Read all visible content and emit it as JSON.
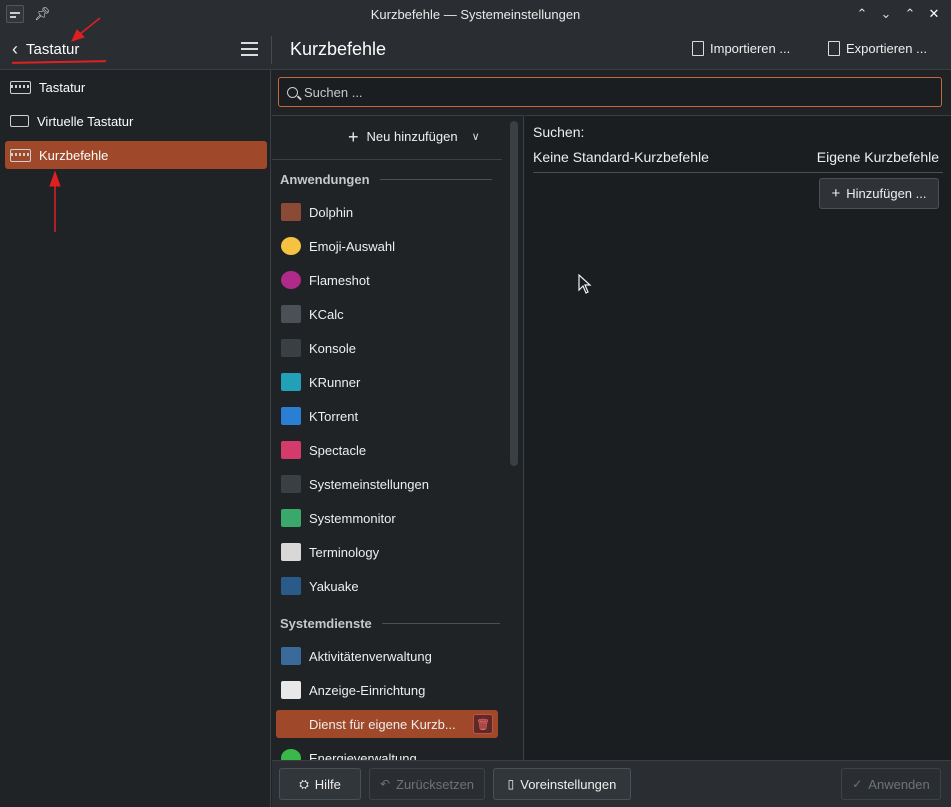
{
  "window": {
    "title": "Kurzbefehle — Systemeinstellungen",
    "controls": [
      "keep-above-icon",
      "minimize-icon",
      "maximize-icon",
      "close-icon"
    ]
  },
  "header": {
    "back_label": "Tastatur",
    "page_title": "Kurzbefehle",
    "import_label": "Importieren ...",
    "export_label": "Exportieren ..."
  },
  "sidebar": {
    "items": [
      {
        "label": "Tastatur",
        "icon": "keyboard-icon",
        "active": false
      },
      {
        "label": "Virtuelle Tastatur",
        "icon": "virtual-keyboard-icon",
        "active": false
      },
      {
        "label": "Kurzbefehle",
        "icon": "keyboard-icon",
        "active": true
      }
    ]
  },
  "search": {
    "placeholder": "Suchen ..."
  },
  "list": {
    "new_label": "Neu hinzufügen",
    "sections": [
      {
        "title": "Anwendungen",
        "items": [
          {
            "label": "Dolphin",
            "icon": "dolphin-icon",
            "color": "#8a4a35"
          },
          {
            "label": "Emoji-Auswahl",
            "icon": "emoji-icon",
            "color": "#f5c242"
          },
          {
            "label": "Flameshot",
            "icon": "flameshot-icon",
            "color": "#b02a8a"
          },
          {
            "label": "KCalc",
            "icon": "kcalc-icon",
            "color": "#4a5056"
          },
          {
            "label": "Konsole",
            "icon": "konsole-icon",
            "color": "#3a3f44"
          },
          {
            "label": "KRunner",
            "icon": "krunner-icon",
            "color": "#22a0b8"
          },
          {
            "label": "KTorrent",
            "icon": "ktorrent-icon",
            "color": "#2a7fd4"
          },
          {
            "label": "Spectacle",
            "icon": "spectacle-icon",
            "color": "#d43a6a"
          },
          {
            "label": "Systemeinstellungen",
            "icon": "system-settings-icon",
            "color": "#3a3f44"
          },
          {
            "label": "Systemmonitor",
            "icon": "system-monitor-icon",
            "color": "#3aa86a"
          },
          {
            "label": "Terminology",
            "icon": "terminology-icon",
            "color": "#d8d8d8"
          },
          {
            "label": "Yakuake",
            "icon": "yakuake-icon",
            "color": "#2a5a8a"
          }
        ]
      },
      {
        "title": "Systemdienste",
        "items": [
          {
            "label": "Aktivitätenverwaltung",
            "icon": "activities-icon",
            "color": "#3a6a9a"
          },
          {
            "label": "Anzeige-Einrichtung",
            "icon": "display-icon",
            "color": "#e8e8e8"
          },
          {
            "label": "Dienst für eigene Kurzb...",
            "icon": "document-icon",
            "color": "#a0492a",
            "active": true
          },
          {
            "label": "Energieverwaltung",
            "icon": "power-icon",
            "color": "#3ab84a"
          }
        ]
      }
    ]
  },
  "detail": {
    "search_label": "Suchen:",
    "col_default": "Keine Standard-Kurzbefehle",
    "col_custom": "Eigene Kurzbefehle",
    "add_label": "Hinzufügen ..."
  },
  "footer": {
    "help_label": "Hilfe",
    "reset_label": "Zurücksetzen",
    "defaults_label": "Voreinstellungen",
    "apply_label": "Anwenden"
  },
  "colors": {
    "accent": "#a0492a",
    "focus": "#c6673f",
    "annotation": "#e02020"
  }
}
